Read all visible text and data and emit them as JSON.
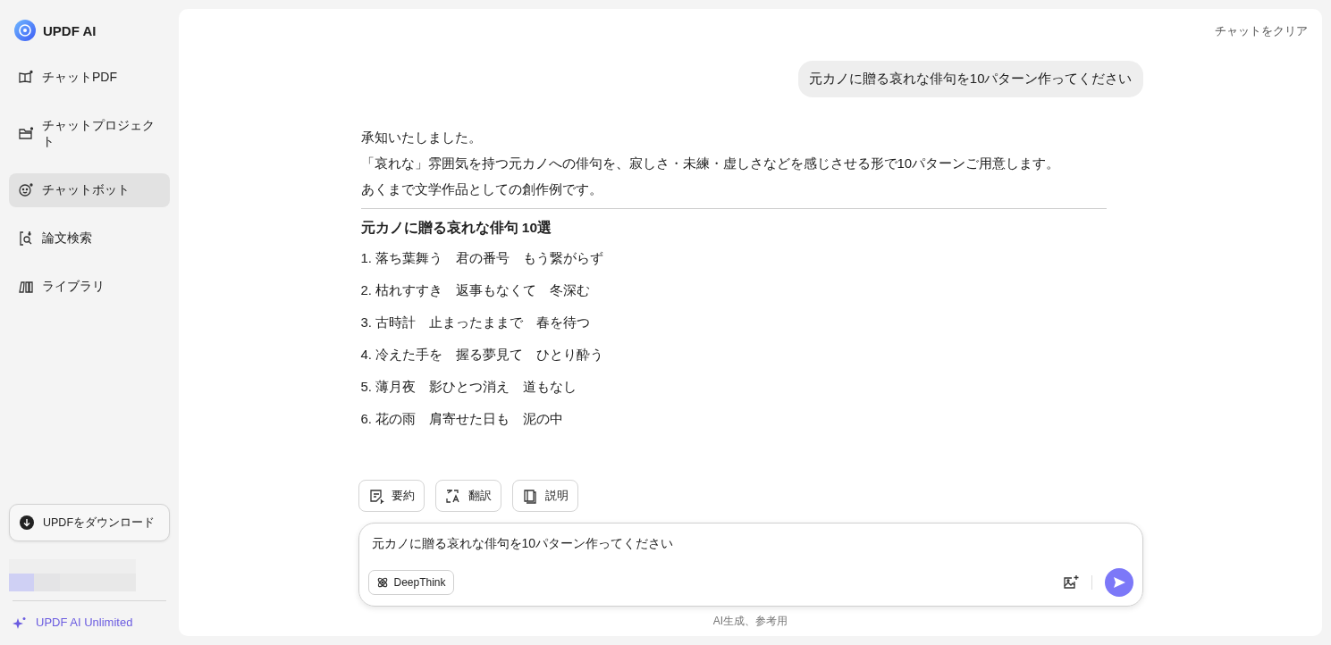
{
  "sidebar": {
    "brand": "UPDF AI",
    "items": [
      {
        "kind": "book",
        "label": "チャットPDF",
        "selected": false
      },
      {
        "kind": "folder",
        "label": "チャットプロジェクト",
        "selected": false
      },
      {
        "kind": "bot",
        "label": "チャットボット",
        "selected": true
      },
      {
        "kind": "search",
        "label": "論文検索",
        "selected": false
      },
      {
        "kind": "library",
        "label": "ライブラリ",
        "selected": false
      }
    ],
    "download_button": "UPDFをダウンロード",
    "upgrade_link": "UPDF AI Unlimited"
  },
  "chat": {
    "clear_button": "チャットをクリア",
    "user_message": "元カノに贈る哀れな俳句を10パターン作ってください",
    "response": {
      "paragraphs": [
        "承知いたしました。",
        "「哀れな」雰囲気を持つ元カノへの俳句を、寂しさ・未練・虚しさなどを感じさせる形で10パターンご用意します。",
        "あくまで文学作品としての創作例です。"
      ],
      "heading": "元カノに贈る哀れな俳句 10選",
      "haiku": [
        "1. 落ち葉舞う　君の番号　もう繋がらず",
        "2. 枯れすすき　返事もなくて　冬深む",
        "3. 古時計　止まったままで　春を待つ",
        "4. 冷えた手を　握る夢見て　ひとり酔う",
        "5. 薄月夜　影ひとつ消え　道もなし",
        "6. 花の雨　肩寄せた日も　泥の中"
      ]
    },
    "actions": [
      {
        "kind": "summary",
        "label": "要約"
      },
      {
        "kind": "translate",
        "label": "翻訳"
      },
      {
        "kind": "explain",
        "label": "説明"
      }
    ],
    "input": {
      "value": "元カノに贈る哀れな俳句を10パターン作ってください",
      "deepthink_button": "DeepThink"
    },
    "footnote": "AI生成、参考用"
  }
}
